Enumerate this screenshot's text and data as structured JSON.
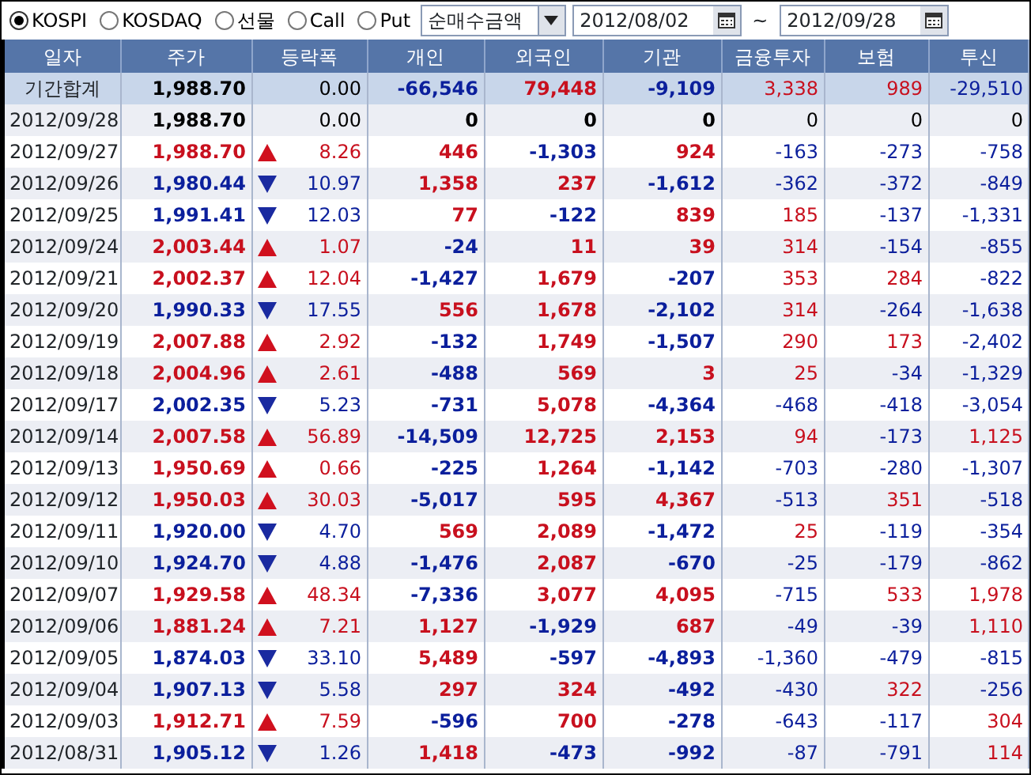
{
  "toolbar": {
    "markets": [
      {
        "label": "KOSPI",
        "selected": true
      },
      {
        "label": "KOSDAQ",
        "selected": false
      },
      {
        "label": "선물",
        "selected": false
      },
      {
        "label": "Call",
        "selected": false
      },
      {
        "label": "Put",
        "selected": false
      }
    ],
    "measure": "순매수금액",
    "date_from": "2012/08/02",
    "range_separator": "~",
    "date_to": "2012/09/28"
  },
  "table": {
    "columns": [
      "일자",
      "주가",
      "등락폭",
      "개인",
      "외국인",
      "기관",
      "금융투자",
      "보험",
      "투신"
    ],
    "rows": [
      {
        "kind": "total",
        "date": "기간합계",
        "price": "1,988.70",
        "up": false,
        "down": false,
        "change": "0.00",
        "values": [
          "-66,546",
          "79,448",
          "-9,109",
          "3,338",
          "989",
          "-29,510"
        ]
      },
      {
        "kind": "day",
        "date": "2012/09/28",
        "price": "1,988.70",
        "up": false,
        "down": false,
        "change": "0.00",
        "values": [
          "0",
          "0",
          "0",
          "0",
          "0",
          "0"
        ]
      },
      {
        "kind": "day",
        "date": "2012/09/27",
        "price": "1,988.70",
        "up": true,
        "down": false,
        "change": "8.26",
        "values": [
          "446",
          "-1,303",
          "924",
          "-163",
          "-273",
          "-758"
        ]
      },
      {
        "kind": "day",
        "date": "2012/09/26",
        "price": "1,980.44",
        "up": false,
        "down": true,
        "change": "10.97",
        "values": [
          "1,358",
          "237",
          "-1,612",
          "-362",
          "-372",
          "-849"
        ]
      },
      {
        "kind": "day",
        "date": "2012/09/25",
        "price": "1,991.41",
        "up": false,
        "down": true,
        "change": "12.03",
        "values": [
          "77",
          "-122",
          "839",
          "185",
          "-137",
          "-1,331"
        ]
      },
      {
        "kind": "day",
        "date": "2012/09/24",
        "price": "2,003.44",
        "up": true,
        "down": false,
        "change": "1.07",
        "values": [
          "-24",
          "11",
          "39",
          "314",
          "-154",
          "-855"
        ]
      },
      {
        "kind": "day",
        "date": "2012/09/21",
        "price": "2,002.37",
        "up": true,
        "down": false,
        "change": "12.04",
        "values": [
          "-1,427",
          "1,679",
          "-207",
          "353",
          "284",
          "-822"
        ]
      },
      {
        "kind": "day",
        "date": "2012/09/20",
        "price": "1,990.33",
        "up": false,
        "down": true,
        "change": "17.55",
        "values": [
          "556",
          "1,678",
          "-2,102",
          "314",
          "-264",
          "-1,638"
        ]
      },
      {
        "kind": "day",
        "date": "2012/09/19",
        "price": "2,007.88",
        "up": true,
        "down": false,
        "change": "2.92",
        "values": [
          "-132",
          "1,749",
          "-1,507",
          "290",
          "173",
          "-2,402"
        ]
      },
      {
        "kind": "day",
        "date": "2012/09/18",
        "price": "2,004.96",
        "up": true,
        "down": false,
        "change": "2.61",
        "values": [
          "-488",
          "569",
          "3",
          "25",
          "-34",
          "-1,329"
        ]
      },
      {
        "kind": "day",
        "date": "2012/09/17",
        "price": "2,002.35",
        "up": false,
        "down": true,
        "change": "5.23",
        "values": [
          "-731",
          "5,078",
          "-4,364",
          "-468",
          "-418",
          "-3,054"
        ]
      },
      {
        "kind": "day",
        "date": "2012/09/14",
        "price": "2,007.58",
        "up": true,
        "down": false,
        "change": "56.89",
        "values": [
          "-14,509",
          "12,725",
          "2,153",
          "94",
          "-173",
          "1,125"
        ]
      },
      {
        "kind": "day",
        "date": "2012/09/13",
        "price": "1,950.69",
        "up": true,
        "down": false,
        "change": "0.66",
        "values": [
          "-225",
          "1,264",
          "-1,142",
          "-703",
          "-280",
          "-1,307"
        ]
      },
      {
        "kind": "day",
        "date": "2012/09/12",
        "price": "1,950.03",
        "up": true,
        "down": false,
        "change": "30.03",
        "values": [
          "-5,017",
          "595",
          "4,367",
          "-513",
          "351",
          "-518"
        ]
      },
      {
        "kind": "day",
        "date": "2012/09/11",
        "price": "1,920.00",
        "up": false,
        "down": true,
        "change": "4.70",
        "values": [
          "569",
          "2,089",
          "-1,472",
          "25",
          "-119",
          "-354"
        ]
      },
      {
        "kind": "day",
        "date": "2012/09/10",
        "price": "1,924.70",
        "up": false,
        "down": true,
        "change": "4.88",
        "values": [
          "-1,476",
          "2,087",
          "-670",
          "-25",
          "-179",
          "-862"
        ]
      },
      {
        "kind": "day",
        "date": "2012/09/07",
        "price": "1,929.58",
        "up": true,
        "down": false,
        "change": "48.34",
        "values": [
          "-7,336",
          "3,077",
          "4,095",
          "-715",
          "533",
          "1,978"
        ]
      },
      {
        "kind": "day",
        "date": "2012/09/06",
        "price": "1,881.24",
        "up": true,
        "down": false,
        "change": "7.21",
        "values": [
          "1,127",
          "-1,929",
          "687",
          "-49",
          "-39",
          "1,110"
        ]
      },
      {
        "kind": "day",
        "date": "2012/09/05",
        "price": "1,874.03",
        "up": false,
        "down": true,
        "change": "33.10",
        "values": [
          "5,489",
          "-597",
          "-4,893",
          "-1,360",
          "-479",
          "-815"
        ]
      },
      {
        "kind": "day",
        "date": "2012/09/04",
        "price": "1,907.13",
        "up": false,
        "down": true,
        "change": "5.58",
        "values": [
          "297",
          "324",
          "-492",
          "-430",
          "322",
          "-256"
        ]
      },
      {
        "kind": "day",
        "date": "2012/09/03",
        "price": "1,912.71",
        "up": true,
        "down": false,
        "change": "7.59",
        "values": [
          "-596",
          "700",
          "-278",
          "-643",
          "-117",
          "304"
        ]
      },
      {
        "kind": "day",
        "date": "2012/08/31",
        "price": "1,905.12",
        "up": false,
        "down": true,
        "change": "1.26",
        "values": [
          "1,418",
          "-473",
          "-992",
          "-87",
          "-791",
          "114"
        ]
      }
    ]
  }
}
